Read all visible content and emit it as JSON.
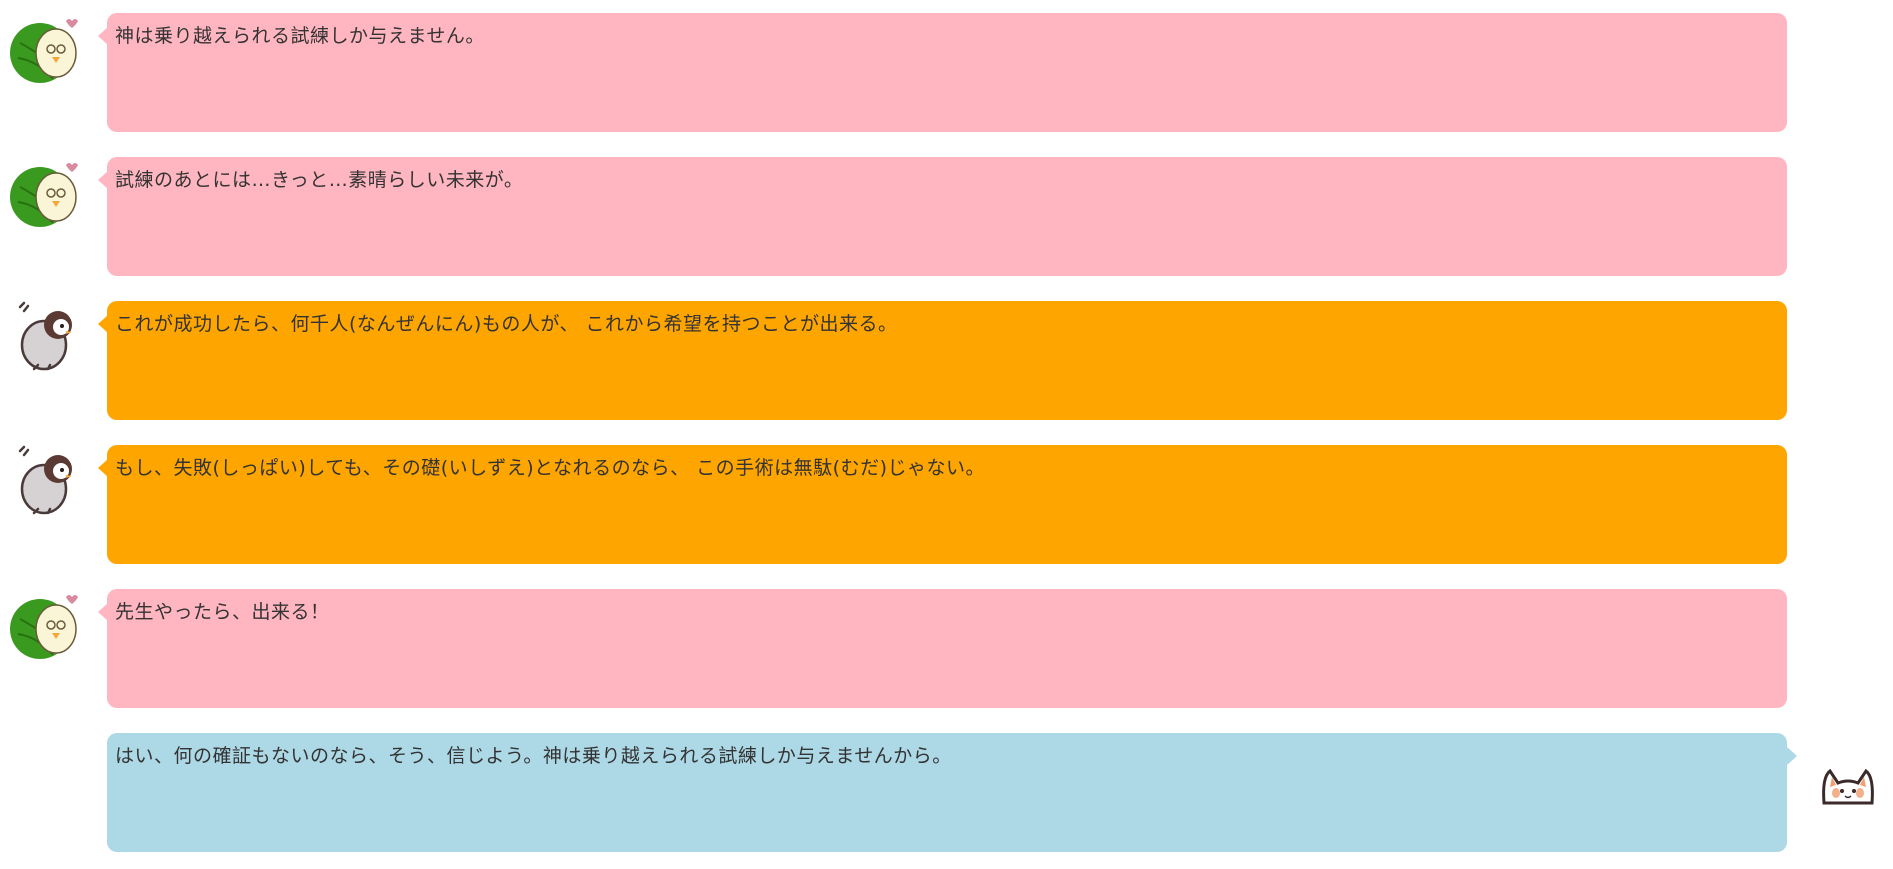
{
  "messages": [
    {
      "speaker": "bird",
      "color": "pink",
      "text": "神は乗り越えられる試練しか与えません。"
    },
    {
      "speaker": "bird",
      "color": "pink",
      "text": "試練のあとには…きっと…素晴らしい未来が。"
    },
    {
      "speaker": "penguin",
      "color": "orange",
      "text": "これが成功したら、何千人(なんぜんにん)もの人が、 これから希望を持つことが出来る。"
    },
    {
      "speaker": "penguin",
      "color": "orange",
      "text": "もし、失敗(しっぱい)しても、その礎(いしずえ)となれるのなら、 この手術は無駄(むだ)じゃない。"
    },
    {
      "speaker": "bird",
      "color": "pink",
      "text": "先生やったら、出来る！"
    },
    {
      "speaker": "cat",
      "color": "blue",
      "text": "はい、何の確証もないのなら、そう、信じよう。神は乗り越えられる試練しか与えませんから。"
    }
  ],
  "colors": {
    "pink": "#ffb6c1",
    "orange": "#ffa500",
    "blue": "#add8e6"
  },
  "icons": {
    "bird": "bird-with-leaf-avatar-icon",
    "penguin": "penguin-chick-avatar-icon",
    "cat": "cat-avatar-icon"
  }
}
